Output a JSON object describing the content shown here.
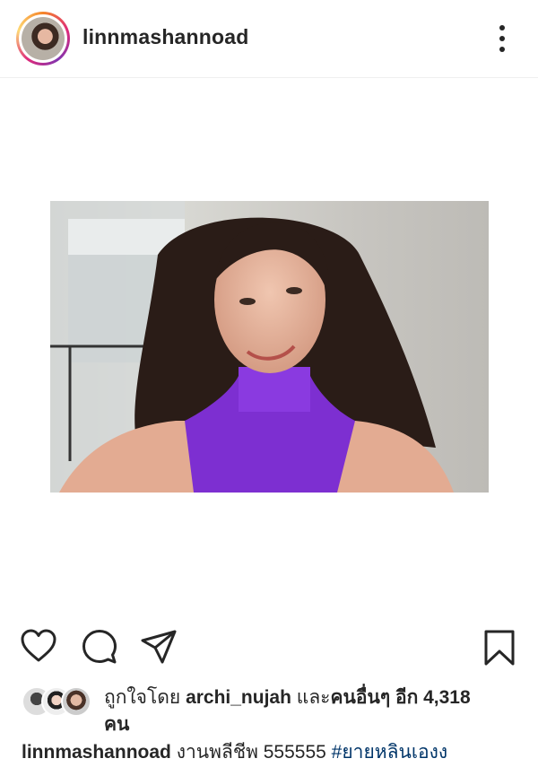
{
  "post": {
    "username": "linnmashannoad",
    "photo_alt": "Selfie photo",
    "likes": {
      "prefix": "ถูกใจโดย",
      "liker": "archi_nujah",
      "and": "และ",
      "others_label": "คนอื่นๆ อีก 4,318",
      "others_line2": "คน"
    },
    "caption": {
      "username": "linnmashannoad",
      "text": "งานพลีชีพ 555555",
      "hashtag": "#ยายหลินเองง"
    }
  },
  "icons": {
    "more": "more-vertical-icon",
    "like": "heart-icon",
    "comment": "comment-icon",
    "share": "send-icon",
    "save": "bookmark-icon"
  }
}
